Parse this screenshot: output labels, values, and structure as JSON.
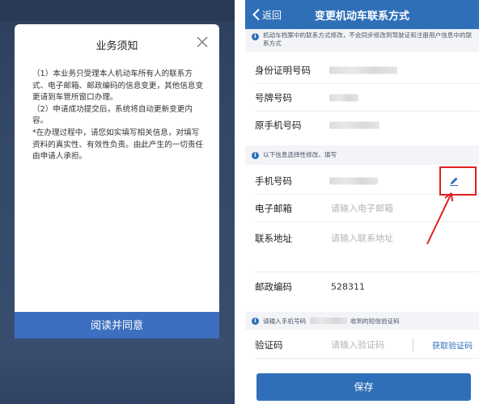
{
  "modal": {
    "title": "业务须知",
    "para1": "（1）本业务只受理本人机动车所有人的联系方式、电子邮箱、邮政编码的信息变更，其他信息变更请到车管所窗口办理。",
    "para2": "（2）申请成功提交后，系统将自动更新变更内容。",
    "para3": "*在办理过程中，请您如实填写相关信息，对填写资料的真实性、有效性负责。由此产生的一切责任由申请人承担。",
    "agree_label": "阅读并同意"
  },
  "form": {
    "back_label": "返回",
    "title": "变更机动车联系方式",
    "notice_top": "机动车档案中的联系方式修改，不会同步修改到驾驶证和注册用户信息中的联系方式",
    "id_label": "身份证明号码",
    "plate_label": "号牌号码",
    "old_phone_label": "原手机号码",
    "notice_mid": "以下信息选择性修改、填写",
    "phone_label": "手机号码",
    "email_label": "电子邮箱",
    "email_placeholder": "请输入电子邮箱",
    "address_label": "联系地址",
    "address_placeholder": "请输入联系地址",
    "postcode_label": "邮政编码",
    "postcode_value": "528311",
    "sms_prefix": "请输入手机号码",
    "sms_suffix": "收到的短信验证码",
    "code_label": "验证码",
    "code_placeholder": "请输入验证码",
    "get_code_label": "获取验证码",
    "save_label": "保存"
  },
  "colors": {
    "brand_blue": "#2f6fb8",
    "agree_blue": "#3c6fc0",
    "highlight_red": "#e02020"
  }
}
